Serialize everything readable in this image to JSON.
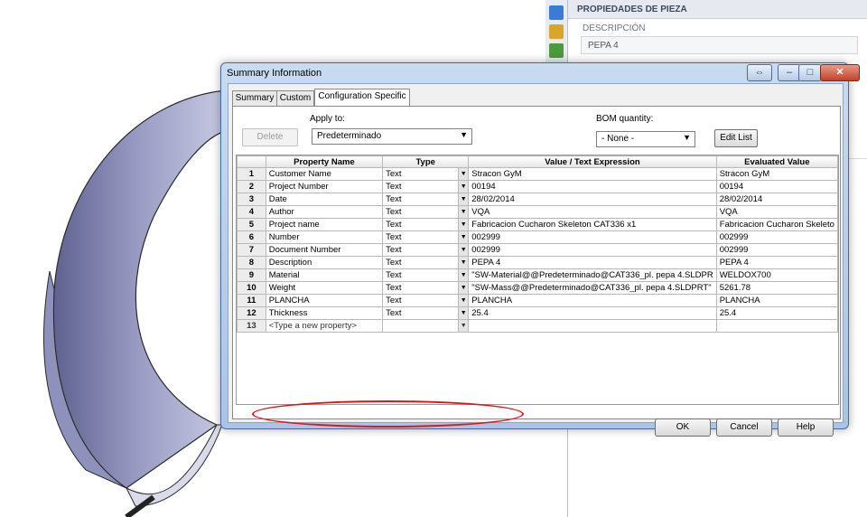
{
  "right_panel": {
    "header": "PROPIEDADES DE PIEZA",
    "description_label": "DESCRIPCIÓN",
    "description_value": "PEPA 4"
  },
  "dialog": {
    "title": "Summary Information",
    "title_buttons": [
      "resize-icon",
      "minimize-icon",
      "maximize-icon",
      "close-icon"
    ],
    "tabs": [
      "Summary",
      "Custom",
      "Configuration Specific"
    ],
    "active_tab": "Configuration Specific",
    "apply_to_label": "Apply to:",
    "apply_to_value": "Predeterminado",
    "delete_label": "Delete",
    "bom_label": "BOM quantity:",
    "bom_value": "- None -",
    "edit_list_label": "Edit List",
    "columns": [
      "Property Name",
      "Type",
      "Value / Text Expression",
      "Evaluated Value"
    ],
    "rows": [
      {
        "num": "1",
        "name": "Customer Name",
        "type": "Text",
        "value": "Stracon GyM",
        "evaluated": "Stracon GyM"
      },
      {
        "num": "2",
        "name": "Project Number",
        "type": "Text",
        "value": "00194",
        "evaluated": "00194"
      },
      {
        "num": "3",
        "name": "Date",
        "type": "Text",
        "value": "28/02/2014",
        "evaluated": "28/02/2014"
      },
      {
        "num": "4",
        "name": "Author",
        "type": "Text",
        "value": "VQA",
        "evaluated": "VQA"
      },
      {
        "num": "5",
        "name": "Project name",
        "type": "Text",
        "value": "Fabricacion Cucharon Skeleton CAT336 x1",
        "evaluated": "Fabricacion Cucharon Skeleto"
      },
      {
        "num": "6",
        "name": "Number",
        "type": "Text",
        "value": "002999",
        "evaluated": "002999"
      },
      {
        "num": "7",
        "name": "Document Number",
        "type": "Text",
        "value": "002999",
        "evaluated": "002999"
      },
      {
        "num": "8",
        "name": "Description",
        "type": "Text",
        "value": "PEPA 4",
        "evaluated": "PEPA 4"
      },
      {
        "num": "9",
        "name": "Material",
        "type": "Text",
        "value": "\"SW-Material@@Predeterminado@CAT336_pl. pepa 4.SLDPR",
        "evaluated": "WELDOX700"
      },
      {
        "num": "10",
        "name": "Weight",
        "type": "Text",
        "value": "\"SW-Mass@@Predeterminado@CAT336_pl. pepa 4.SLDPRT\"",
        "evaluated": "5261.78"
      },
      {
        "num": "11",
        "name": "PLANCHA",
        "type": "Text",
        "value": "PLANCHA",
        "evaluated": "PLANCHA"
      },
      {
        "num": "12",
        "name": "Thickness",
        "type": "Text",
        "value": "25.4",
        "evaluated": "25.4"
      },
      {
        "num": "13",
        "name": "<Type a new property>",
        "type": "",
        "value": "",
        "evaluated": ""
      }
    ],
    "ok_label": "OK",
    "cancel_label": "Cancel",
    "help_label": "Help"
  }
}
